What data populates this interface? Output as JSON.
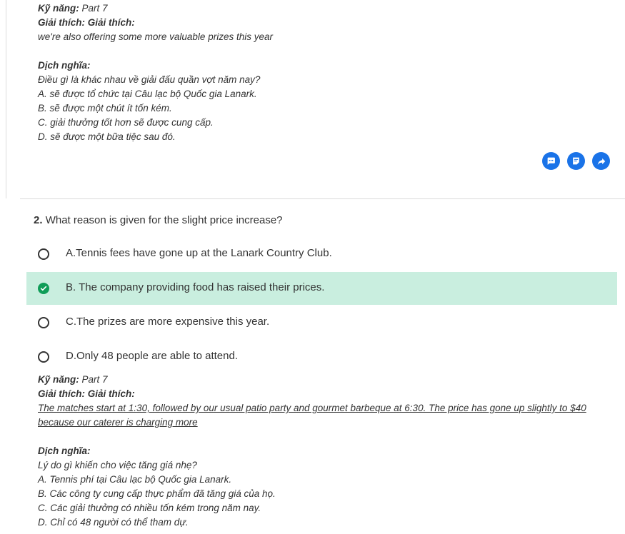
{
  "previous": {
    "skill_label": "Kỹ năng:",
    "skill_value": "Part 7",
    "explanation_label": "Giải thích: Giải thích:",
    "explanation_text": "we're also offering some more valuable prizes this year",
    "translation_label": "Dịch nghĩa:",
    "translation_lines": [
      "Điều gì là khác nhau về giải đấu quần vợt năm nay?",
      "A. sẽ được tổ chức tại Câu lạc bộ Quốc gia Lanark.",
      "B. sẽ được một chút ít tốn kém.",
      "C. giải thưởng tốt hơn sẽ được cung cấp.",
      "D. sẽ được một bữa tiệc sau đó."
    ]
  },
  "actions": [
    {
      "name": "comment-icon",
      "color": "#1a73e8"
    },
    {
      "name": "note-icon",
      "color": "#1a73e8"
    },
    {
      "name": "share-icon",
      "color": "#1a73e8"
    }
  ],
  "question": {
    "number": "2.",
    "text": "What reason is given for the slight price increase?",
    "options": [
      {
        "label": "A.Tennis fees have gone up at the Lanark Country Club.",
        "selected": false
      },
      {
        "label": "B. The company providing food has raised their prices.",
        "selected": true
      },
      {
        "label": "C.The prizes are more expensive this year.",
        "selected": false
      },
      {
        "label": "D.Only 48 people are able to attend.",
        "selected": false
      }
    ],
    "selected_color": "#c9eedf",
    "check_color": "#0f9d58"
  },
  "current": {
    "skill_label": "Kỹ năng:",
    "skill_value": "Part 7",
    "explanation_label": "Giải thích: Giải thích:",
    "explanation_text": "The matches start at 1:30, followed by our usual patio party and gourmet barbeque at 6:30. The price has gone up slightly to $40 because our caterer is charging more",
    "translation_label": "Dịch nghĩa:",
    "translation_lines": [
      "Lý do gì khiến cho việc tăng giá nhẹ?",
      "A. Tennis phí tại Câu lạc bộ Quốc gia Lanark.",
      "B. Các công ty cung cấp thực phẩm đã tăng giá của họ.",
      "C. Các giải thưởng có nhiều tốn kém trong năm nay.",
      "D. Chỉ có 48 người có thể tham dự."
    ]
  }
}
